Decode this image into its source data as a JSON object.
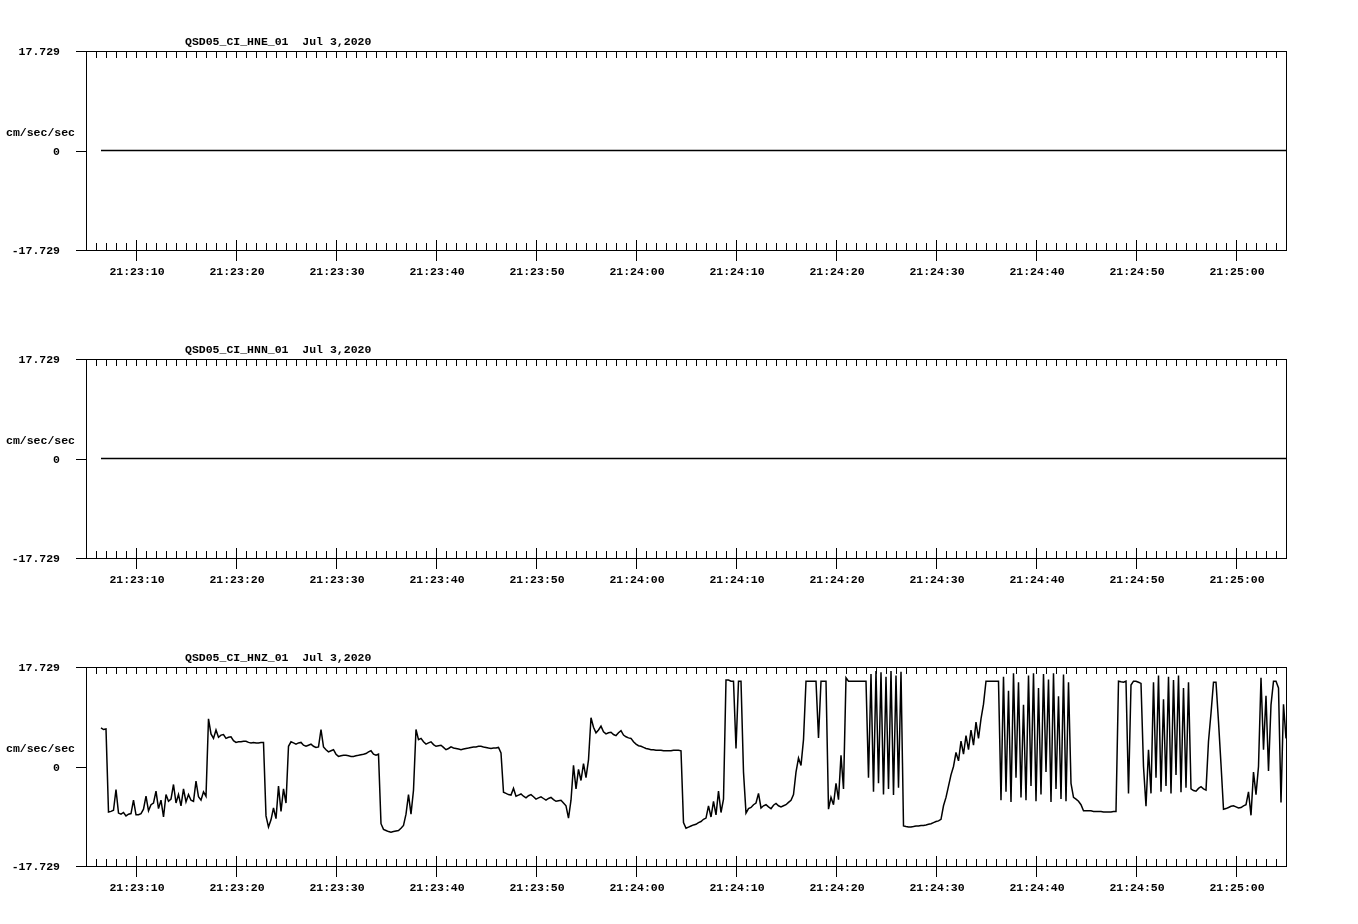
{
  "charts": [
    {
      "chart_data": {
        "type": "line",
        "title": "QSD05_CI_HNE_01  Jul 3,2020",
        "ylabel": "cm/sec/sec",
        "categories": [
          null,
          null,
          null,
          null,
          null,
          null,
          null,
          null,
          null,
          null,
          "21:23:10",
          null,
          null,
          null,
          null,
          null,
          null,
          null,
          null,
          null,
          null,
          null,
          null,
          null,
          null,
          null,
          null,
          null,
          null,
          null,
          "21:23:20",
          null,
          null,
          null,
          null,
          null,
          null,
          null,
          null,
          null,
          null,
          null,
          null,
          null,
          null,
          null,
          null,
          null,
          null,
          null,
          "21:23:30",
          null,
          null,
          null,
          null,
          null,
          null,
          null,
          null,
          null,
          null,
          null,
          null,
          null,
          null,
          null,
          null,
          null,
          null,
          null,
          "21:23:40",
          null,
          null,
          null,
          null,
          null,
          null,
          null,
          null,
          null,
          null,
          null,
          null,
          null,
          null,
          null,
          null,
          null,
          null,
          null,
          "21:23:50",
          null,
          null,
          null,
          null,
          null,
          null,
          null,
          null,
          null,
          null,
          null,
          null,
          null,
          null,
          null,
          null,
          null,
          null,
          null,
          "21:24:00",
          null,
          null,
          null,
          null,
          null,
          null,
          null,
          null,
          null,
          null,
          null,
          null,
          null,
          null,
          null,
          null,
          null,
          null,
          null,
          "21:24:10",
          null,
          null,
          null,
          null,
          null,
          null,
          null,
          null,
          null,
          null,
          null,
          null,
          null,
          null,
          null,
          null,
          null,
          null,
          null,
          "21:24:20",
          null,
          null,
          null,
          null,
          null,
          null,
          null,
          null,
          null,
          null,
          null,
          null,
          null,
          null,
          null,
          null,
          null,
          null,
          null,
          "21:24:30",
          null,
          null,
          null,
          null,
          null,
          null,
          null,
          null,
          null,
          null,
          null,
          null,
          null,
          null,
          null,
          null,
          null,
          null,
          null,
          "21:24:40",
          null,
          null,
          null,
          null,
          null,
          null,
          null,
          null,
          null,
          null,
          null,
          null,
          null,
          null,
          null,
          null,
          null,
          null,
          null,
          "21:24:50",
          null,
          null,
          null,
          null,
          null,
          null,
          null,
          null,
          null,
          null,
          null,
          null,
          null,
          null,
          null,
          null,
          null,
          null,
          null,
          "21:25:00",
          null,
          null,
          null,
          null,
          null,
          null,
          null,
          null,
          null,
          null
        ],
        "series": [
          {
            "color": "#000000",
            "values": [
              null,
              null,
              null,
              0,
              0,
              0,
              0,
              0,
              0,
              0,
              0,
              0,
              0,
              0,
              0,
              0,
              0,
              0,
              0,
              0,
              0,
              0,
              0,
              0,
              0,
              0,
              0,
              0,
              0,
              0,
              0,
              0,
              0,
              0,
              0,
              0,
              0,
              0,
              0,
              0,
              0,
              0,
              0,
              0,
              0,
              0,
              0,
              0,
              0,
              0,
              0,
              0,
              0,
              0,
              0,
              0,
              0,
              0,
              0,
              0,
              0,
              0,
              0,
              0,
              0,
              0,
              0,
              0,
              0,
              0,
              0,
              0,
              0,
              0,
              0,
              0,
              0,
              0,
              0,
              0,
              0,
              0,
              0,
              0,
              0,
              0,
              0,
              0,
              0,
              0,
              0,
              0,
              0,
              0,
              0,
              0,
              0,
              0,
              0,
              0,
              0,
              0,
              0,
              0,
              0,
              0,
              0,
              0,
              0,
              0,
              0,
              0,
              0,
              0,
              0,
              0,
              0,
              0,
              0,
              0,
              0,
              0,
              0,
              0,
              0,
              0,
              0,
              0,
              0,
              0,
              0,
              0,
              0,
              0,
              0,
              0,
              0,
              0,
              0,
              0,
              0,
              0,
              0,
              0,
              0,
              0,
              0,
              0,
              0,
              0,
              0,
              0,
              0,
              0,
              0,
              0,
              0,
              0,
              0,
              0,
              0,
              0,
              0,
              0,
              0,
              0,
              0,
              0,
              0,
              0,
              0,
              0,
              0,
              0,
              0,
              0,
              0,
              0,
              0,
              0,
              0,
              0,
              0,
              0,
              0,
              0,
              0,
              0,
              0,
              0,
              0,
              0,
              0,
              0,
              0,
              0,
              0,
              0,
              0,
              0,
              0,
              0,
              0,
              0,
              0,
              0,
              0,
              0,
              0,
              0,
              0,
              0,
              0,
              0,
              0,
              0,
              0,
              0,
              0,
              0,
              0,
              0,
              0,
              0,
              0,
              0,
              0,
              0,
              0,
              0,
              0,
              0,
              0,
              0,
              0,
              0,
              0,
              0,
              0,
              0,
              0
            ]
          }
        ],
        "ylim": [
          -17.729,
          17.729
        ],
        "yticks": [
          {
            "value": 17.729,
            "label": "17.729"
          },
          {
            "value": 0,
            "label": "0"
          },
          {
            "value": -17.729,
            "label": "-17.729"
          }
        ]
      }
    },
    {
      "chart_data": {
        "type": "line",
        "title": "QSD05_CI_HNN_01  Jul 3,2020",
        "ylabel": "cm/sec/sec",
        "categories": [
          null,
          null,
          null,
          null,
          null,
          null,
          null,
          null,
          null,
          null,
          "21:23:10",
          null,
          null,
          null,
          null,
          null,
          null,
          null,
          null,
          null,
          null,
          null,
          null,
          null,
          null,
          null,
          null,
          null,
          null,
          null,
          "21:23:20",
          null,
          null,
          null,
          null,
          null,
          null,
          null,
          null,
          null,
          null,
          null,
          null,
          null,
          null,
          null,
          null,
          null,
          null,
          null,
          "21:23:30",
          null,
          null,
          null,
          null,
          null,
          null,
          null,
          null,
          null,
          null,
          null,
          null,
          null,
          null,
          null,
          null,
          null,
          null,
          null,
          "21:23:40",
          null,
          null,
          null,
          null,
          null,
          null,
          null,
          null,
          null,
          null,
          null,
          null,
          null,
          null,
          null,
          null,
          null,
          null,
          null,
          "21:23:50",
          null,
          null,
          null,
          null,
          null,
          null,
          null,
          null,
          null,
          null,
          null,
          null,
          null,
          null,
          null,
          null,
          null,
          null,
          null,
          "21:24:00",
          null,
          null,
          null,
          null,
          null,
          null,
          null,
          null,
          null,
          null,
          null,
          null,
          null,
          null,
          null,
          null,
          null,
          null,
          null,
          "21:24:10",
          null,
          null,
          null,
          null,
          null,
          null,
          null,
          null,
          null,
          null,
          null,
          null,
          null,
          null,
          null,
          null,
          null,
          null,
          null,
          "21:24:20",
          null,
          null,
          null,
          null,
          null,
          null,
          null,
          null,
          null,
          null,
          null,
          null,
          null,
          null,
          null,
          null,
          null,
          null,
          null,
          "21:24:30",
          null,
          null,
          null,
          null,
          null,
          null,
          null,
          null,
          null,
          null,
          null,
          null,
          null,
          null,
          null,
          null,
          null,
          null,
          null,
          "21:24:40",
          null,
          null,
          null,
          null,
          null,
          null,
          null,
          null,
          null,
          null,
          null,
          null,
          null,
          null,
          null,
          null,
          null,
          null,
          null,
          "21:24:50",
          null,
          null,
          null,
          null,
          null,
          null,
          null,
          null,
          null,
          null,
          null,
          null,
          null,
          null,
          null,
          null,
          null,
          null,
          null,
          "21:25:00",
          null,
          null,
          null,
          null,
          null,
          null,
          null,
          null,
          null,
          null
        ],
        "series": [
          {
            "color": "#000000",
            "values": [
              null,
              null,
              null,
              0,
              0,
              0,
              0,
              0,
              0,
              0,
              0,
              0,
              0,
              0,
              0,
              0,
              0,
              0,
              0,
              0,
              0,
              0,
              0,
              0,
              0,
              0,
              0,
              0,
              0,
              0,
              0,
              0,
              0,
              0,
              0,
              0,
              0,
              0,
              0,
              0,
              0,
              0,
              0,
              0,
              0,
              0,
              0,
              0,
              0,
              0,
              0,
              0,
              0,
              0,
              0,
              0,
              0,
              0,
              0,
              0,
              0,
              0,
              0,
              0,
              0,
              0,
              0,
              0,
              0,
              0,
              0,
              0,
              0,
              0,
              0,
              0,
              0,
              0,
              0,
              0,
              0,
              0,
              0,
              0,
              0,
              0,
              0,
              0,
              0,
              0,
              0,
              0,
              0,
              0,
              0,
              0,
              0,
              0,
              0,
              0,
              0,
              0,
              0,
              0,
              0,
              0,
              0,
              0,
              0,
              0,
              0,
              0,
              0,
              0,
              0,
              0,
              0,
              0,
              0,
              0,
              0,
              0,
              0,
              0,
              0,
              0,
              0,
              0,
              0,
              0,
              0,
              0,
              0,
              0,
              0,
              0,
              0,
              0,
              0,
              0,
              0,
              0,
              0,
              0,
              0,
              0,
              0,
              0,
              0,
              0,
              0,
              0,
              0,
              0,
              0,
              0,
              0,
              0,
              0,
              0,
              0,
              0,
              0,
              0,
              0,
              0,
              0,
              0,
              0,
              0,
              0,
              0,
              0,
              0,
              0,
              0,
              0,
              0,
              0,
              0,
              0,
              0,
              0,
              0,
              0,
              0,
              0,
              0,
              0,
              0,
              0,
              0,
              0,
              0,
              0,
              0,
              0,
              0,
              0,
              0,
              0,
              0,
              0,
              0,
              0,
              0,
              0,
              0,
              0,
              0,
              0,
              0,
              0,
              0,
              0,
              0,
              0,
              0,
              0,
              0,
              0,
              0,
              0,
              0,
              0,
              0,
              0,
              0,
              0,
              0,
              0,
              0,
              0,
              0,
              0,
              0,
              0,
              0,
              0,
              0,
              0
            ]
          }
        ],
        "ylim": [
          -17.729,
          17.729
        ],
        "yticks": [
          {
            "value": 17.729,
            "label": "17.729"
          },
          {
            "value": 0,
            "label": "0"
          },
          {
            "value": -17.729,
            "label": "-17.729"
          }
        ]
      }
    },
    {
      "chart_data": {
        "type": "line",
        "title": "QSD05_CI_HNZ_01  Jul 3,2020",
        "ylabel": "cm/sec/sec",
        "categories": [
          null,
          null,
          null,
          null,
          null,
          null,
          null,
          null,
          null,
          null,
          null,
          null,
          null,
          null,
          null,
          null,
          null,
          null,
          null,
          null,
          "21:23:10",
          null,
          null,
          null,
          null,
          null,
          null,
          null,
          null,
          null,
          null,
          null,
          null,
          null,
          null,
          null,
          null,
          null,
          null,
          null,
          null,
          null,
          null,
          null,
          null,
          null,
          null,
          null,
          null,
          null,
          null,
          null,
          null,
          null,
          null,
          null,
          null,
          null,
          null,
          null,
          "21:23:20",
          null,
          null,
          null,
          null,
          null,
          null,
          null,
          null,
          null,
          null,
          null,
          null,
          null,
          null,
          null,
          null,
          null,
          null,
          null,
          null,
          null,
          null,
          null,
          null,
          null,
          null,
          null,
          null,
          null,
          null,
          null,
          null,
          null,
          null,
          null,
          null,
          null,
          null,
          null,
          "21:23:30",
          null,
          null,
          null,
          null,
          null,
          null,
          null,
          null,
          null,
          null,
          null,
          null,
          null,
          null,
          null,
          null,
          null,
          null,
          null,
          null,
          null,
          null,
          null,
          null,
          null,
          null,
          null,
          null,
          null,
          null,
          null,
          null,
          null,
          null,
          null,
          null,
          null,
          null,
          null,
          "21:23:40",
          null,
          null,
          null,
          null,
          null,
          null,
          null,
          null,
          null,
          null,
          null,
          null,
          null,
          null,
          null,
          null,
          null,
          null,
          null,
          null,
          null,
          null,
          null,
          null,
          null,
          null,
          null,
          null,
          null,
          null,
          null,
          null,
          null,
          null,
          null,
          null,
          null,
          null,
          null,
          "21:23:50",
          null,
          null,
          null,
          null,
          null,
          null,
          null,
          null,
          null,
          null,
          null,
          null,
          null,
          null,
          null,
          null,
          null,
          null,
          null,
          null,
          null,
          null,
          null,
          null,
          null,
          null,
          null,
          null,
          null,
          null,
          null,
          null,
          null,
          null,
          null,
          null,
          null,
          null,
          null,
          "21:24:00",
          null,
          null,
          null,
          null,
          null,
          null,
          null,
          null,
          null,
          null,
          null,
          null,
          null,
          null,
          null,
          null,
          null,
          null,
          null,
          null,
          null,
          null,
          null,
          null,
          null,
          null,
          null,
          null,
          null,
          null,
          null,
          null,
          null,
          null,
          null,
          null,
          null,
          null,
          null,
          "21:24:10",
          null,
          null,
          null,
          null,
          null,
          null,
          null,
          null,
          null,
          null,
          null,
          null,
          null,
          null,
          null,
          null,
          null,
          null,
          null,
          null,
          null,
          null,
          null,
          null,
          null,
          null,
          null,
          null,
          null,
          null,
          null,
          null,
          null,
          null,
          null,
          null,
          null,
          null,
          null,
          "21:24:20",
          null,
          null,
          null,
          null,
          null,
          null,
          null,
          null,
          null,
          null,
          null,
          null,
          null,
          null,
          null,
          null,
          null,
          null,
          null,
          null,
          null,
          null,
          null,
          null,
          null,
          null,
          null,
          null,
          null,
          null,
          null,
          null,
          null,
          null,
          null,
          null,
          null,
          null,
          null,
          "21:24:30",
          null,
          null,
          null,
          null,
          null,
          null,
          null,
          null,
          null,
          null,
          null,
          null,
          null,
          null,
          null,
          null,
          null,
          null,
          null,
          null,
          null,
          null,
          null,
          null,
          null,
          null,
          null,
          null,
          null,
          null,
          null,
          null,
          null,
          null,
          null,
          null,
          null,
          null,
          null,
          "21:24:40",
          null,
          null,
          null,
          null,
          null,
          null,
          null,
          null,
          null,
          null,
          null,
          null,
          null,
          null,
          null,
          null,
          null,
          null,
          null,
          null,
          null,
          null,
          null,
          null,
          null,
          null,
          null,
          null,
          null,
          null,
          null,
          null,
          null,
          null,
          null,
          null,
          null,
          null,
          null,
          "21:24:50",
          null,
          null,
          null,
          null,
          null,
          null,
          null,
          null,
          null,
          null,
          null,
          null,
          null,
          null,
          null,
          null,
          null,
          null,
          null,
          null,
          null,
          null,
          null,
          null,
          null,
          null,
          null,
          null,
          null,
          null,
          null,
          null,
          null,
          null,
          null,
          null,
          null,
          null,
          null,
          "21:25:00",
          null,
          null,
          null,
          null,
          null,
          null,
          null,
          null,
          null,
          null,
          null,
          null,
          null,
          null,
          null,
          null,
          null,
          null,
          null,
          null
        ],
        "series": [
          {
            "color": "#000000",
            "values": [
              null,
              null,
              null,
              null,
              null,
              null,
              6.9,
              6.6,
              6.7,
              -8.1,
              -8.0,
              -7.8,
              -4.1,
              -8.3,
              -8.5,
              -8.2,
              -8.8,
              -8.5,
              -8.4,
              -6.0,
              -8.6,
              -8.6,
              -8.4,
              -7.6,
              -5.3,
              -7.9,
              -6.8,
              -6.5,
              -4.4,
              -7.5,
              -6.0,
              -9.0,
              -5.0,
              -6.2,
              -5.8,
              -3.2,
              -6.5,
              -5.0,
              -7.0,
              -4.0,
              -6.3,
              -5.0,
              -6.0,
              -6.2,
              -2.6,
              -5.4,
              -6.0,
              -4.5,
              -5.3,
              8.5,
              5.8,
              5.0,
              6.5,
              5.2,
              5.6,
              5.7,
              5.0,
              5.2,
              5.3,
              4.6,
              4.3,
              4.4,
              4.4,
              4.5,
              4.5,
              4.3,
              4.2,
              4.3,
              4.2,
              4.2,
              4.3,
              4.3,
              -8.8,
              -10.8,
              -9.5,
              -7.4,
              -9.3,
              -3.5,
              -8.0,
              -4.0,
              -6.5,
              3.6,
              4.4,
              4.2,
              4.0,
              4.2,
              4.3,
              3.8,
              3.6,
              3.8,
              4.0,
              3.6,
              3.4,
              3.5,
              6.6,
              3.5,
              3.0,
              2.6,
              2.8,
              3.0,
              2.2,
              1.8,
              1.9,
              2.0,
              2.0,
              1.9,
              1.8,
              1.8,
              1.9,
              2.0,
              2.1,
              2.2,
              2.3,
              2.6,
              2.8,
              2.2,
              2.0,
              2.2,
              -10.2,
              -11.2,
              -11.4,
              -11.6,
              -11.7,
              -11.6,
              -11.5,
              -11.4,
              -11.0,
              -10.5,
              -8.5,
              -5.0,
              -8.5,
              -4.2,
              6.6,
              4.8,
              5.0,
              4.4,
              4.0,
              4.2,
              4.4,
              3.9,
              3.6,
              3.7,
              3.8,
              3.4,
              3.0,
              3.2,
              3.5,
              3.3,
              3.2,
              3.1,
              3.0,
              3.1,
              3.2,
              3.3,
              3.4,
              3.5,
              3.5,
              3.6,
              3.6,
              3.5,
              3.4,
              3.3,
              3.2,
              3.3,
              3.3,
              3.4,
              2.4,
              -4.6,
              -4.8,
              -5.0,
              -5.1,
              -3.9,
              -5.3,
              -5.1,
              -4.9,
              -5.3,
              -5.6,
              -5.2,
              -5.0,
              -5.4,
              -5.8,
              -5.6,
              -5.4,
              -5.7,
              -6.0,
              -5.7,
              -5.5,
              -5.9,
              -6.2,
              -6.1,
              -6.0,
              -6.5,
              -7.0,
              -9.2,
              -6.0,
              0.2,
              -4.0,
              -0.5,
              -2.5,
              0.5,
              -2.0,
              1.2,
              8.7,
              7.0,
              6.0,
              6.5,
              7.2,
              6.2,
              5.8,
              6.0,
              6.1,
              5.7,
              5.5,
              6.0,
              6.4,
              5.6,
              5.3,
              5.1,
              5.0,
              4.4,
              4.0,
              3.7,
              3.6,
              3.4,
              3.2,
              3.1,
              3.0,
              3.0,
              2.9,
              2.9,
              2.9,
              2.8,
              2.8,
              2.8,
              2.8,
              2.9,
              2.9,
              2.9,
              2.8,
              -10.0,
              -11.0,
              -10.8,
              -10.6,
              -10.4,
              -10.3,
              -10.0,
              -9.8,
              -9.4,
              -9.2,
              -7.0,
              -9.0,
              -6.2,
              -8.6,
              -4.4,
              -8.2,
              -5.8,
              15.4,
              15.4,
              15.2,
              15.2,
              3.2,
              15.2,
              15.2,
              -1.0,
              -8.3,
              -7.5,
              -7.3,
              -6.8,
              -6.5,
              -4.8,
              -7.4,
              -7.0,
              -6.8,
              -7.2,
              -7.5,
              -6.9,
              -6.6,
              -7.0,
              -7.2,
              -7.0,
              -6.8,
              -6.4,
              -6.0,
              -5.0,
              -1.0,
              1.5,
              0.2,
              4.8,
              15.2,
              15.2,
              15.2,
              15.2,
              15.2,
              5.1,
              15.2,
              15.2,
              15.2,
              -7.6,
              -5.5,
              -6.8,
              -3.0,
              -5.9,
              2.0,
              -4.0,
              15.8,
              15.2,
              15.2,
              15.2,
              15.2,
              15.2,
              15.2,
              15.2,
              15.2,
              -2.0,
              16.5,
              -4.5,
              17.0,
              -3.0,
              16.8,
              -5.0,
              16.0,
              -4.0,
              17.0,
              -5.1,
              16.2,
              -3.8,
              16.9,
              -10.6,
              -10.7,
              -10.8,
              -10.8,
              -10.7,
              -10.6,
              -10.6,
              -10.5,
              -10.5,
              -10.4,
              -10.3,
              -10.2,
              -10.0,
              -9.8,
              -9.7,
              -9.4,
              -7.0,
              -5.5,
              -3.5,
              -1.5,
              0.0,
              2.5,
              1.0,
              4.5,
              2.2,
              5.5,
              3.0,
              6.5,
              3.8,
              7.9,
              5.0,
              8.5,
              11.1,
              15.2,
              15.2,
              15.2,
              15.2,
              15.2,
              15.2,
              -6.0,
              16.0,
              -4.5,
              13.5,
              -6.3,
              16.6,
              -2.0,
              15.0,
              -5.5,
              11.0,
              -6.0,
              16.2,
              -3.5,
              16.6,
              -6.2,
              14.0,
              -5.0,
              16.5,
              -1.0,
              15.5,
              -6.3,
              16.6,
              -4.0,
              12.5,
              -5.8,
              16.4,
              -6.2,
              15.0,
              -3.0,
              -5.5,
              -5.8,
              -6.2,
              -6.8,
              -7.9,
              -7.9,
              -7.9,
              -7.9,
              -8.0,
              -8.0,
              -8.0,
              -8.0,
              -8.1,
              -8.1,
              -8.1,
              -8.1,
              -8.0,
              -8.0,
              15.2,
              15.1,
              15.0,
              15.2,
              -4.8,
              14.5,
              15.2,
              15.2,
              15.0,
              14.8,
              0.0,
              -7.1,
              3.0,
              -4.8,
              15.0,
              -2.0,
              16.2,
              -4.5,
              12.0,
              -3.5,
              16.0,
              -4.8,
              15.4,
              -1.5,
              16.2,
              -4.6,
              14.0,
              -3.8,
              15.0,
              -4.0,
              -4.3,
              -4.4,
              -3.9,
              -3.6,
              -4.0,
              -4.2,
              4.5,
              9.5,
              15.0,
              15.0,
              8.0,
              0.4,
              -7.6,
              -7.5,
              -7.3,
              -7.1,
              -7.0,
              -7.2,
              -7.4,
              -7.3,
              -7.0,
              -6.8,
              -4.5,
              -8.7,
              -1.0,
              -5.0,
              0.0,
              15.8,
              3.0,
              12.6,
              -0.8,
              11.0,
              15.2,
              15.2,
              14.0,
              -6.4,
              11.1,
              5.0
            ]
          }
        ],
        "ylim": [
          -17.729,
          17.729
        ],
        "yticks": [
          {
            "value": 17.729,
            "label": "17.729"
          },
          {
            "value": 0,
            "label": "0"
          },
          {
            "value": -17.729,
            "label": "-17.729"
          }
        ]
      }
    }
  ]
}
